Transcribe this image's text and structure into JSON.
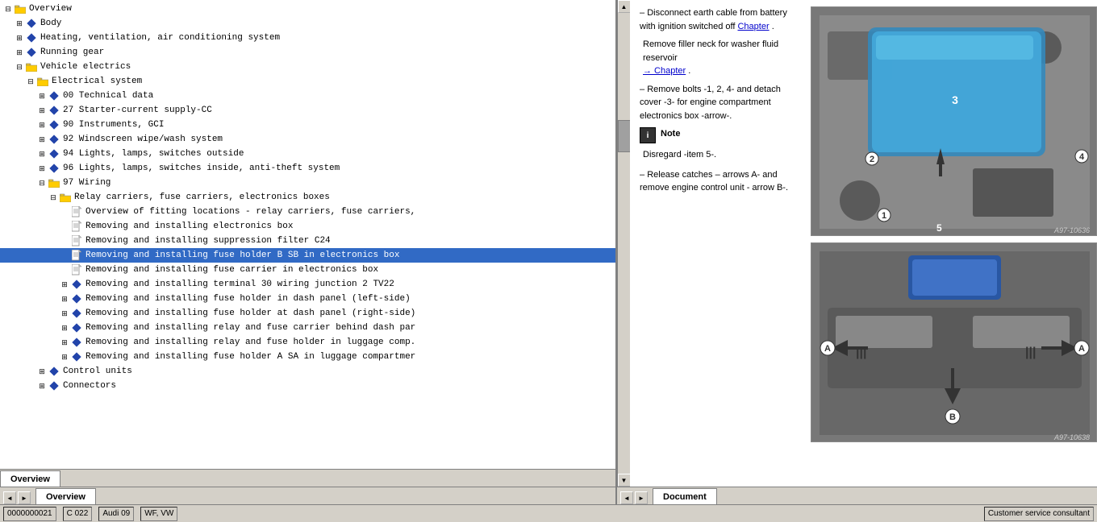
{
  "left_panel": {
    "tree_items": [
      {
        "id": 1,
        "label": "Overview",
        "indent": 0,
        "type": "folder_open",
        "expanded": true
      },
      {
        "id": 2,
        "label": "Body",
        "indent": 1,
        "type": "diamond",
        "expanded": false
      },
      {
        "id": 3,
        "label": "Heating, ventilation, air conditioning system",
        "indent": 1,
        "type": "diamond",
        "expanded": false
      },
      {
        "id": 4,
        "label": "Running gear",
        "indent": 1,
        "type": "diamond",
        "expanded": false
      },
      {
        "id": 5,
        "label": "Vehicle electrics",
        "indent": 1,
        "type": "folder_open",
        "expanded": true
      },
      {
        "id": 6,
        "label": "Electrical system",
        "indent": 2,
        "type": "folder_open",
        "expanded": true
      },
      {
        "id": 7,
        "label": "00 Technical data",
        "indent": 3,
        "type": "diamond",
        "expanded": false
      },
      {
        "id": 8,
        "label": "27 Starter-current supply-CC",
        "indent": 3,
        "type": "diamond",
        "expanded": false
      },
      {
        "id": 9,
        "label": "90 Instruments, GCI",
        "indent": 3,
        "type": "diamond",
        "expanded": false
      },
      {
        "id": 10,
        "label": "92 Windscreen wipe/wash system",
        "indent": 3,
        "type": "diamond",
        "expanded": false
      },
      {
        "id": 11,
        "label": "94 Lights, lamps, switches outside",
        "indent": 3,
        "type": "diamond",
        "expanded": false
      },
      {
        "id": 12,
        "label": "96 Lights, lamps, switches inside, anti-theft system",
        "indent": 3,
        "type": "diamond",
        "expanded": false
      },
      {
        "id": 13,
        "label": "97 Wiring",
        "indent": 3,
        "type": "folder_open",
        "expanded": true
      },
      {
        "id": 14,
        "label": "Relay carriers, fuse carriers, electronics boxes",
        "indent": 4,
        "type": "folder_open",
        "expanded": true
      },
      {
        "id": 15,
        "label": "Overview of fitting locations - relay carriers, fuse carriers,",
        "indent": 5,
        "type": "doc",
        "expanded": false
      },
      {
        "id": 16,
        "label": "Removing and installing electronics box",
        "indent": 5,
        "type": "doc",
        "expanded": false
      },
      {
        "id": 17,
        "label": "Removing and installing suppression filter C24",
        "indent": 5,
        "type": "doc",
        "expanded": false
      },
      {
        "id": 18,
        "label": "Removing and installing fuse holder B SB in electronics box",
        "indent": 5,
        "type": "doc",
        "selected": true,
        "expanded": false
      },
      {
        "id": 19,
        "label": "Removing and installing fuse carrier in electronics box",
        "indent": 5,
        "type": "doc",
        "expanded": false
      },
      {
        "id": 20,
        "label": "Removing and installing terminal 30 wiring junction 2 TV22",
        "indent": 5,
        "type": "diamond",
        "expanded": false
      },
      {
        "id": 21,
        "label": "Removing and installing fuse holder in dash panel (left-side)",
        "indent": 5,
        "type": "diamond",
        "expanded": false
      },
      {
        "id": 22,
        "label": "Removing and installing fuse holder at dash panel (right-side)",
        "indent": 5,
        "type": "diamond",
        "expanded": false
      },
      {
        "id": 23,
        "label": "Removing and installing relay and fuse carrier behind dash par",
        "indent": 5,
        "type": "diamond",
        "expanded": false
      },
      {
        "id": 24,
        "label": "Removing and installing relay and fuse holder in luggage comp.",
        "indent": 5,
        "type": "diamond",
        "expanded": false
      },
      {
        "id": 25,
        "label": "Removing and installing fuse holder A SA in luggage compartmer",
        "indent": 5,
        "type": "diamond",
        "expanded": false
      },
      {
        "id": 26,
        "label": "Control units",
        "indent": 3,
        "type": "diamond",
        "expanded": false
      },
      {
        "id": 27,
        "label": "Connectors",
        "indent": 3,
        "type": "diamond",
        "expanded": false
      }
    ],
    "tabs": [
      {
        "id": "overview",
        "label": "Overview",
        "active": true
      }
    ]
  },
  "right_panel": {
    "instructions": [
      {
        "text": "Disconnect earth cable from battery with ignition switched off",
        "link": "Chapter",
        "prefix": "–"
      },
      {
        "text": "Remove filler neck for washer fluid reservoir",
        "link": "Chapter",
        "prefix": ""
      },
      {
        "text": "Remove bolts -1, 2, 4- and detach cover -3- for engine compartment electronics box -arrow-.",
        "prefix": "–"
      },
      {
        "text": "Note",
        "type": "note"
      },
      {
        "text": "Disregard -item 5-.",
        "type": "note_text"
      },
      {
        "text": "Release catches – arrows A- and remove engine control unit - arrow B-.",
        "prefix": "–"
      }
    ],
    "image_top": {
      "labels": [
        "3",
        "2",
        "4",
        "1",
        "5"
      ],
      "code": "A97-10636"
    },
    "image_bottom": {
      "labels": [
        "A",
        "A",
        "B"
      ],
      "code": "A97-10638"
    },
    "tabs": [
      {
        "id": "document",
        "label": "Document",
        "active": true
      }
    ]
  },
  "status_bar": {
    "page_info": "0000000021",
    "doc_ref": "C 022",
    "car_model": "Audi 09",
    "specs": "WF, VW",
    "consultant": "Customer service consultant"
  },
  "colors": {
    "accent_blue": "#316ac5",
    "link_color": "#0000cc",
    "highlight": "#99ccff",
    "selected": "#316ac5"
  }
}
